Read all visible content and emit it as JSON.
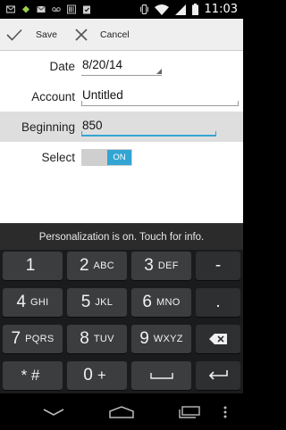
{
  "status_bar": {
    "time": "11:03",
    "left_icons": [
      "email-icon",
      "hangouts-icon",
      "gmail-icon",
      "voicemail-icon",
      "barcode-icon",
      "clipboard-icon"
    ],
    "right_icons": [
      "vibrate-icon",
      "wifi-icon",
      "signal-icon",
      "battery-icon"
    ]
  },
  "action_bar": {
    "save_label": "Save",
    "cancel_label": "Cancel"
  },
  "form": {
    "date": {
      "label": "Date",
      "value": "8/20/14"
    },
    "account": {
      "label": "Account",
      "value": "Untitled"
    },
    "beginning": {
      "label": "Beginning",
      "value": "850"
    },
    "select": {
      "label": "Select",
      "value": "ON"
    }
  },
  "keyboard": {
    "suggestion": "Personalization is on. Touch for info.",
    "keys": [
      {
        "num": "1",
        "letters": ""
      },
      {
        "num": "2",
        "letters": "ABC"
      },
      {
        "num": "3",
        "letters": "DEF"
      },
      {
        "num": "4",
        "letters": "GHI"
      },
      {
        "num": "5",
        "letters": "JKL"
      },
      {
        "num": "6",
        "letters": "MNO"
      },
      {
        "num": "7",
        "letters": "PQRS"
      },
      {
        "num": "8",
        "letters": "TUV"
      },
      {
        "num": "9",
        "letters": "WXYZ"
      },
      {
        "num": "* #",
        "letters": ""
      },
      {
        "num": "0",
        "letters": "+"
      }
    ],
    "minus": "-",
    "dot": "."
  },
  "colors": {
    "accent": "#33a5d3",
    "action_bar_bg": "#efefef",
    "keyboard_bg": "#1a1b1c",
    "key_bg": "#3c3d3f",
    "highlight_row": "#dedede"
  }
}
